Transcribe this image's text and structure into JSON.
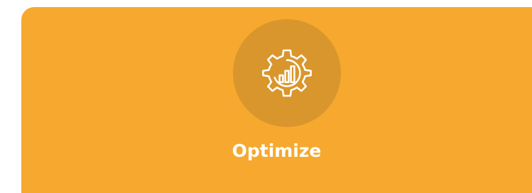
{
  "card": {
    "title": "Optimize",
    "icon": "gear-chart-icon",
    "background_color": "#f6a92e",
    "icon_circle_color": "#d9962c",
    "text_color": "#ffffff"
  }
}
